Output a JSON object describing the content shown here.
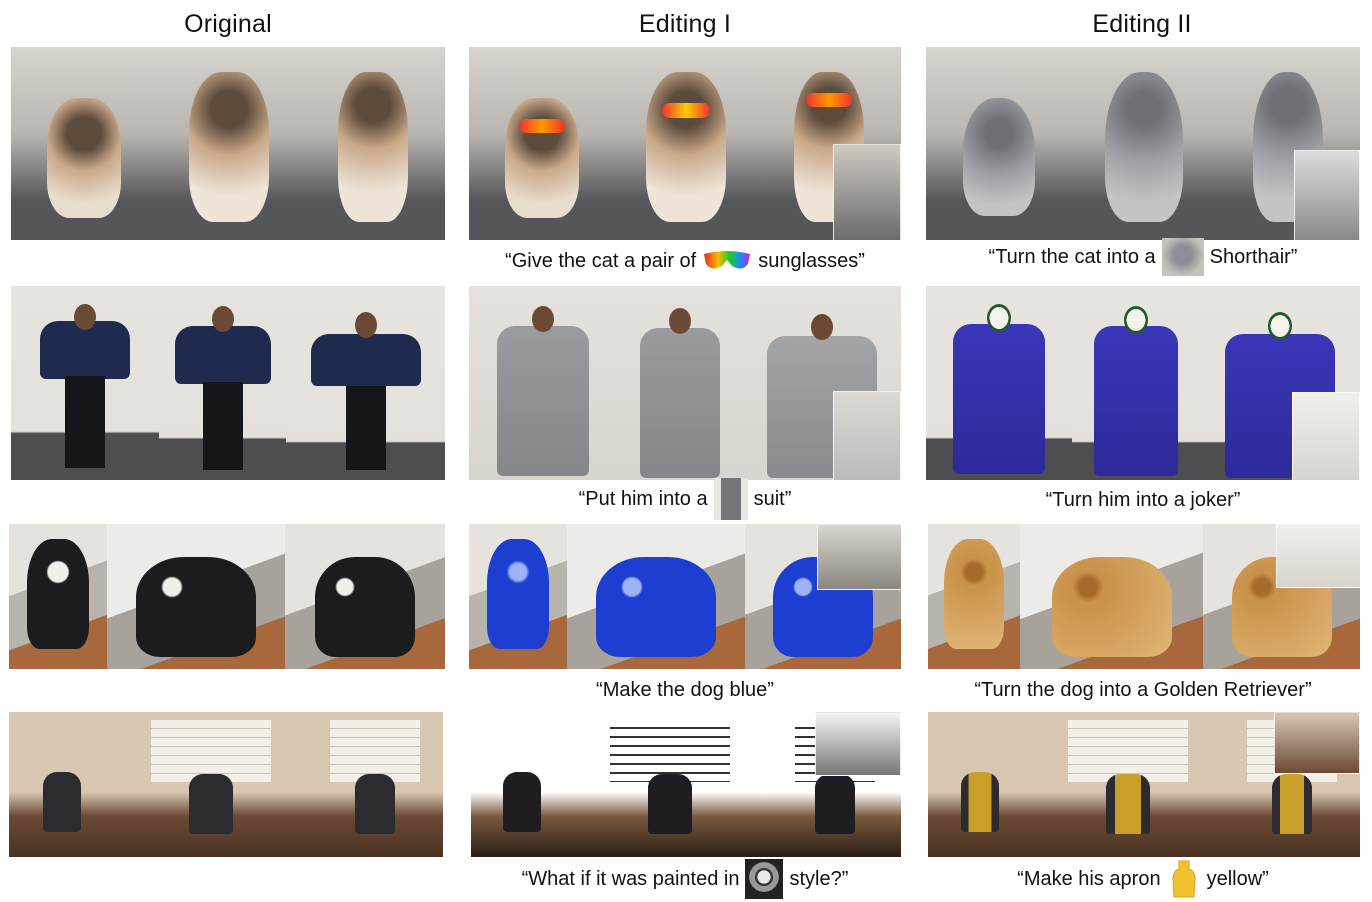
{
  "columns": {
    "original": "Original",
    "editing1": "Editing I",
    "editing2": "Editing II"
  },
  "captions": {
    "row1_e1_before": "“Give the cat a pair of",
    "row1_e1_after": "sunglasses”",
    "row1_e2_before": "“Turn the cat into a",
    "row1_e2_after": "Shorthair”",
    "row2_e1_before": "“Put him into a",
    "row2_e1_after": "suit”",
    "row2_e2": "“Turn him into a joker”",
    "row3_e1": "“Make the dog blue”",
    "row3_e2": "“Turn the dog into a Golden Retriever”",
    "row4_e1_before": "“What if it was painted in",
    "row4_e1_after": "style?”",
    "row4_e2_before": "“Make his apron",
    "row4_e2_after": "yellow”"
  },
  "colors": {
    "sofa": "#b9b6b1",
    "floor_gray": "#55565a",
    "cat_fluffy": "#c9a98a",
    "cat_gray": "#9c9ea3",
    "wall": "#e4e1dc",
    "sweater": "#1f2a4f",
    "suit": "#8f9093",
    "joker": "#3a36b8",
    "dog_black": "#1c1c1f",
    "dog_blue": "#1d3fd1",
    "dog_golden": "#c9914a",
    "kitchen": "#8c6b4f"
  }
}
